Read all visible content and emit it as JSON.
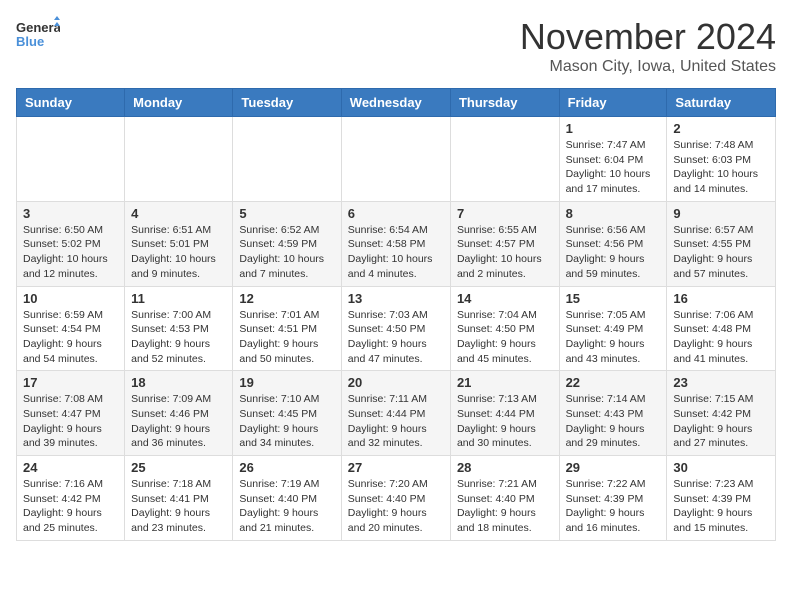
{
  "logo": {
    "general": "General",
    "blue": "Blue"
  },
  "title": "November 2024",
  "location": "Mason City, Iowa, United States",
  "days_of_week": [
    "Sunday",
    "Monday",
    "Tuesday",
    "Wednesday",
    "Thursday",
    "Friday",
    "Saturday"
  ],
  "weeks": [
    [
      {
        "day": "",
        "info": ""
      },
      {
        "day": "",
        "info": ""
      },
      {
        "day": "",
        "info": ""
      },
      {
        "day": "",
        "info": ""
      },
      {
        "day": "",
        "info": ""
      },
      {
        "day": "1",
        "info": "Sunrise: 7:47 AM\nSunset: 6:04 PM\nDaylight: 10 hours and 17 minutes."
      },
      {
        "day": "2",
        "info": "Sunrise: 7:48 AM\nSunset: 6:03 PM\nDaylight: 10 hours and 14 minutes."
      }
    ],
    [
      {
        "day": "3",
        "info": "Sunrise: 6:50 AM\nSunset: 5:02 PM\nDaylight: 10 hours and 12 minutes."
      },
      {
        "day": "4",
        "info": "Sunrise: 6:51 AM\nSunset: 5:01 PM\nDaylight: 10 hours and 9 minutes."
      },
      {
        "day": "5",
        "info": "Sunrise: 6:52 AM\nSunset: 4:59 PM\nDaylight: 10 hours and 7 minutes."
      },
      {
        "day": "6",
        "info": "Sunrise: 6:54 AM\nSunset: 4:58 PM\nDaylight: 10 hours and 4 minutes."
      },
      {
        "day": "7",
        "info": "Sunrise: 6:55 AM\nSunset: 4:57 PM\nDaylight: 10 hours and 2 minutes."
      },
      {
        "day": "8",
        "info": "Sunrise: 6:56 AM\nSunset: 4:56 PM\nDaylight: 9 hours and 59 minutes."
      },
      {
        "day": "9",
        "info": "Sunrise: 6:57 AM\nSunset: 4:55 PM\nDaylight: 9 hours and 57 minutes."
      }
    ],
    [
      {
        "day": "10",
        "info": "Sunrise: 6:59 AM\nSunset: 4:54 PM\nDaylight: 9 hours and 54 minutes."
      },
      {
        "day": "11",
        "info": "Sunrise: 7:00 AM\nSunset: 4:53 PM\nDaylight: 9 hours and 52 minutes."
      },
      {
        "day": "12",
        "info": "Sunrise: 7:01 AM\nSunset: 4:51 PM\nDaylight: 9 hours and 50 minutes."
      },
      {
        "day": "13",
        "info": "Sunrise: 7:03 AM\nSunset: 4:50 PM\nDaylight: 9 hours and 47 minutes."
      },
      {
        "day": "14",
        "info": "Sunrise: 7:04 AM\nSunset: 4:50 PM\nDaylight: 9 hours and 45 minutes."
      },
      {
        "day": "15",
        "info": "Sunrise: 7:05 AM\nSunset: 4:49 PM\nDaylight: 9 hours and 43 minutes."
      },
      {
        "day": "16",
        "info": "Sunrise: 7:06 AM\nSunset: 4:48 PM\nDaylight: 9 hours and 41 minutes."
      }
    ],
    [
      {
        "day": "17",
        "info": "Sunrise: 7:08 AM\nSunset: 4:47 PM\nDaylight: 9 hours and 39 minutes."
      },
      {
        "day": "18",
        "info": "Sunrise: 7:09 AM\nSunset: 4:46 PM\nDaylight: 9 hours and 36 minutes."
      },
      {
        "day": "19",
        "info": "Sunrise: 7:10 AM\nSunset: 4:45 PM\nDaylight: 9 hours and 34 minutes."
      },
      {
        "day": "20",
        "info": "Sunrise: 7:11 AM\nSunset: 4:44 PM\nDaylight: 9 hours and 32 minutes."
      },
      {
        "day": "21",
        "info": "Sunrise: 7:13 AM\nSunset: 4:44 PM\nDaylight: 9 hours and 30 minutes."
      },
      {
        "day": "22",
        "info": "Sunrise: 7:14 AM\nSunset: 4:43 PM\nDaylight: 9 hours and 29 minutes."
      },
      {
        "day": "23",
        "info": "Sunrise: 7:15 AM\nSunset: 4:42 PM\nDaylight: 9 hours and 27 minutes."
      }
    ],
    [
      {
        "day": "24",
        "info": "Sunrise: 7:16 AM\nSunset: 4:42 PM\nDaylight: 9 hours and 25 minutes."
      },
      {
        "day": "25",
        "info": "Sunrise: 7:18 AM\nSunset: 4:41 PM\nDaylight: 9 hours and 23 minutes."
      },
      {
        "day": "26",
        "info": "Sunrise: 7:19 AM\nSunset: 4:40 PM\nDaylight: 9 hours and 21 minutes."
      },
      {
        "day": "27",
        "info": "Sunrise: 7:20 AM\nSunset: 4:40 PM\nDaylight: 9 hours and 20 minutes."
      },
      {
        "day": "28",
        "info": "Sunrise: 7:21 AM\nSunset: 4:40 PM\nDaylight: 9 hours and 18 minutes."
      },
      {
        "day": "29",
        "info": "Sunrise: 7:22 AM\nSunset: 4:39 PM\nDaylight: 9 hours and 16 minutes."
      },
      {
        "day": "30",
        "info": "Sunrise: 7:23 AM\nSunset: 4:39 PM\nDaylight: 9 hours and 15 minutes."
      }
    ]
  ]
}
